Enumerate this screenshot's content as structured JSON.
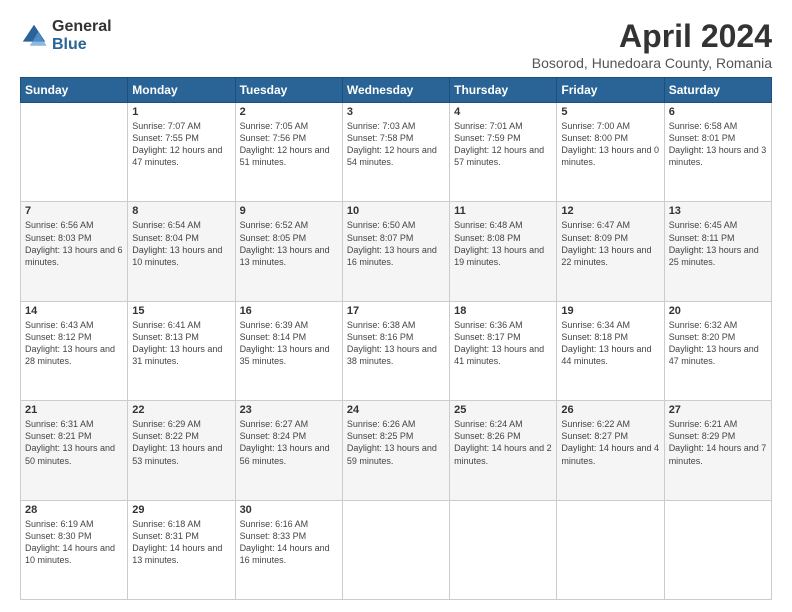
{
  "logo": {
    "general": "General",
    "blue": "Blue"
  },
  "title": "April 2024",
  "subtitle": "Bosorod, Hunedoara County, Romania",
  "weekdays": [
    "Sunday",
    "Monday",
    "Tuesday",
    "Wednesday",
    "Thursday",
    "Friday",
    "Saturday"
  ],
  "weeks": [
    [
      {
        "day": "",
        "sunrise": "",
        "sunset": "",
        "daylight": ""
      },
      {
        "day": "1",
        "sunrise": "Sunrise: 7:07 AM",
        "sunset": "Sunset: 7:55 PM",
        "daylight": "Daylight: 12 hours and 47 minutes."
      },
      {
        "day": "2",
        "sunrise": "Sunrise: 7:05 AM",
        "sunset": "Sunset: 7:56 PM",
        "daylight": "Daylight: 12 hours and 51 minutes."
      },
      {
        "day": "3",
        "sunrise": "Sunrise: 7:03 AM",
        "sunset": "Sunset: 7:58 PM",
        "daylight": "Daylight: 12 hours and 54 minutes."
      },
      {
        "day": "4",
        "sunrise": "Sunrise: 7:01 AM",
        "sunset": "Sunset: 7:59 PM",
        "daylight": "Daylight: 12 hours and 57 minutes."
      },
      {
        "day": "5",
        "sunrise": "Sunrise: 7:00 AM",
        "sunset": "Sunset: 8:00 PM",
        "daylight": "Daylight: 13 hours and 0 minutes."
      },
      {
        "day": "6",
        "sunrise": "Sunrise: 6:58 AM",
        "sunset": "Sunset: 8:01 PM",
        "daylight": "Daylight: 13 hours and 3 minutes."
      }
    ],
    [
      {
        "day": "7",
        "sunrise": "Sunrise: 6:56 AM",
        "sunset": "Sunset: 8:03 PM",
        "daylight": "Daylight: 13 hours and 6 minutes."
      },
      {
        "day": "8",
        "sunrise": "Sunrise: 6:54 AM",
        "sunset": "Sunset: 8:04 PM",
        "daylight": "Daylight: 13 hours and 10 minutes."
      },
      {
        "day": "9",
        "sunrise": "Sunrise: 6:52 AM",
        "sunset": "Sunset: 8:05 PM",
        "daylight": "Daylight: 13 hours and 13 minutes."
      },
      {
        "day": "10",
        "sunrise": "Sunrise: 6:50 AM",
        "sunset": "Sunset: 8:07 PM",
        "daylight": "Daylight: 13 hours and 16 minutes."
      },
      {
        "day": "11",
        "sunrise": "Sunrise: 6:48 AM",
        "sunset": "Sunset: 8:08 PM",
        "daylight": "Daylight: 13 hours and 19 minutes."
      },
      {
        "day": "12",
        "sunrise": "Sunrise: 6:47 AM",
        "sunset": "Sunset: 8:09 PM",
        "daylight": "Daylight: 13 hours and 22 minutes."
      },
      {
        "day": "13",
        "sunrise": "Sunrise: 6:45 AM",
        "sunset": "Sunset: 8:11 PM",
        "daylight": "Daylight: 13 hours and 25 minutes."
      }
    ],
    [
      {
        "day": "14",
        "sunrise": "Sunrise: 6:43 AM",
        "sunset": "Sunset: 8:12 PM",
        "daylight": "Daylight: 13 hours and 28 minutes."
      },
      {
        "day": "15",
        "sunrise": "Sunrise: 6:41 AM",
        "sunset": "Sunset: 8:13 PM",
        "daylight": "Daylight: 13 hours and 31 minutes."
      },
      {
        "day": "16",
        "sunrise": "Sunrise: 6:39 AM",
        "sunset": "Sunset: 8:14 PM",
        "daylight": "Daylight: 13 hours and 35 minutes."
      },
      {
        "day": "17",
        "sunrise": "Sunrise: 6:38 AM",
        "sunset": "Sunset: 8:16 PM",
        "daylight": "Daylight: 13 hours and 38 minutes."
      },
      {
        "day": "18",
        "sunrise": "Sunrise: 6:36 AM",
        "sunset": "Sunset: 8:17 PM",
        "daylight": "Daylight: 13 hours and 41 minutes."
      },
      {
        "day": "19",
        "sunrise": "Sunrise: 6:34 AM",
        "sunset": "Sunset: 8:18 PM",
        "daylight": "Daylight: 13 hours and 44 minutes."
      },
      {
        "day": "20",
        "sunrise": "Sunrise: 6:32 AM",
        "sunset": "Sunset: 8:20 PM",
        "daylight": "Daylight: 13 hours and 47 minutes."
      }
    ],
    [
      {
        "day": "21",
        "sunrise": "Sunrise: 6:31 AM",
        "sunset": "Sunset: 8:21 PM",
        "daylight": "Daylight: 13 hours and 50 minutes."
      },
      {
        "day": "22",
        "sunrise": "Sunrise: 6:29 AM",
        "sunset": "Sunset: 8:22 PM",
        "daylight": "Daylight: 13 hours and 53 minutes."
      },
      {
        "day": "23",
        "sunrise": "Sunrise: 6:27 AM",
        "sunset": "Sunset: 8:24 PM",
        "daylight": "Daylight: 13 hours and 56 minutes."
      },
      {
        "day": "24",
        "sunrise": "Sunrise: 6:26 AM",
        "sunset": "Sunset: 8:25 PM",
        "daylight": "Daylight: 13 hours and 59 minutes."
      },
      {
        "day": "25",
        "sunrise": "Sunrise: 6:24 AM",
        "sunset": "Sunset: 8:26 PM",
        "daylight": "Daylight: 14 hours and 2 minutes."
      },
      {
        "day": "26",
        "sunrise": "Sunrise: 6:22 AM",
        "sunset": "Sunset: 8:27 PM",
        "daylight": "Daylight: 14 hours and 4 minutes."
      },
      {
        "day": "27",
        "sunrise": "Sunrise: 6:21 AM",
        "sunset": "Sunset: 8:29 PM",
        "daylight": "Daylight: 14 hours and 7 minutes."
      }
    ],
    [
      {
        "day": "28",
        "sunrise": "Sunrise: 6:19 AM",
        "sunset": "Sunset: 8:30 PM",
        "daylight": "Daylight: 14 hours and 10 minutes."
      },
      {
        "day": "29",
        "sunrise": "Sunrise: 6:18 AM",
        "sunset": "Sunset: 8:31 PM",
        "daylight": "Daylight: 14 hours and 13 minutes."
      },
      {
        "day": "30",
        "sunrise": "Sunrise: 6:16 AM",
        "sunset": "Sunset: 8:33 PM",
        "daylight": "Daylight: 14 hours and 16 minutes."
      },
      {
        "day": "",
        "sunrise": "",
        "sunset": "",
        "daylight": ""
      },
      {
        "day": "",
        "sunrise": "",
        "sunset": "",
        "daylight": ""
      },
      {
        "day": "",
        "sunrise": "",
        "sunset": "",
        "daylight": ""
      },
      {
        "day": "",
        "sunrise": "",
        "sunset": "",
        "daylight": ""
      }
    ]
  ]
}
